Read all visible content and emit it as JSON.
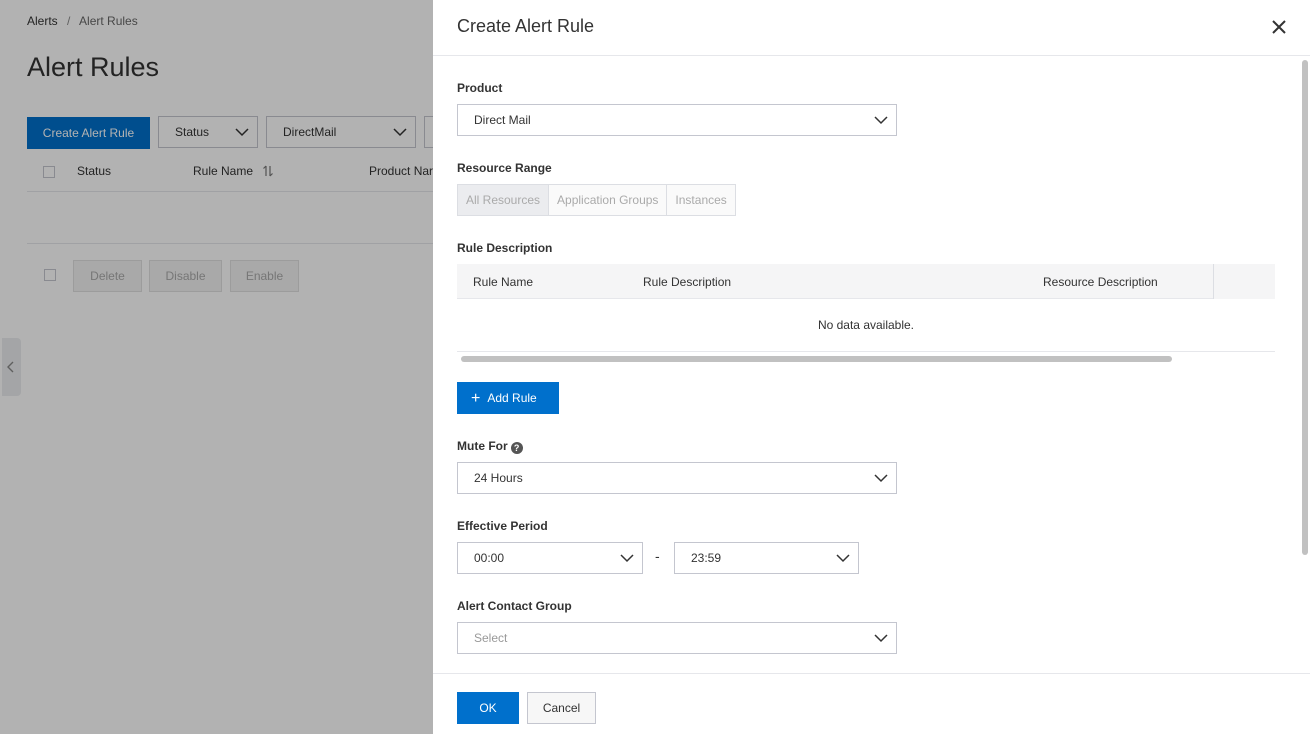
{
  "background": {
    "breadcrumb": {
      "root": "Alerts",
      "separator": "/",
      "current": "Alert Rules"
    },
    "page_title": "Alert Rules",
    "create_button": "Create Alert Rule",
    "filters": {
      "status": "Status",
      "product": "DirectMail"
    },
    "table_headers": {
      "status": "Status",
      "rule_name": "Rule Name",
      "product_name": "Product Nar"
    },
    "batch_actions": {
      "delete": "Delete",
      "disable": "Disable",
      "enable": "Enable"
    }
  },
  "drawer": {
    "title": "Create Alert Rule",
    "product": {
      "label": "Product",
      "value": "Direct Mail"
    },
    "resource_range": {
      "label": "Resource Range",
      "options": [
        "All Resources",
        "Application Groups",
        "Instances"
      ],
      "selected": "All Resources"
    },
    "rule_description": {
      "label": "Rule Description",
      "columns": [
        "Rule Name",
        "Rule Description",
        "Resource Description"
      ],
      "empty_text": "No data available."
    },
    "add_rule_button": "Add Rule",
    "mute_for": {
      "label": "Mute For",
      "value": "24 Hours"
    },
    "effective_period": {
      "label": "Effective Period",
      "start": "00:00",
      "separator": "-",
      "end": "23:59"
    },
    "alert_contact_group": {
      "label": "Alert Contact Group",
      "placeholder": "Select"
    },
    "footer": {
      "ok": "OK",
      "cancel": "Cancel"
    }
  },
  "colors": {
    "primary": "#0070cc",
    "mask": "rgba(0,0,0,0.3)"
  },
  "icons": [
    "close-icon",
    "chevron-down-icon",
    "plus-icon",
    "help-icon",
    "sort-icon",
    "chevron-left-icon"
  ]
}
